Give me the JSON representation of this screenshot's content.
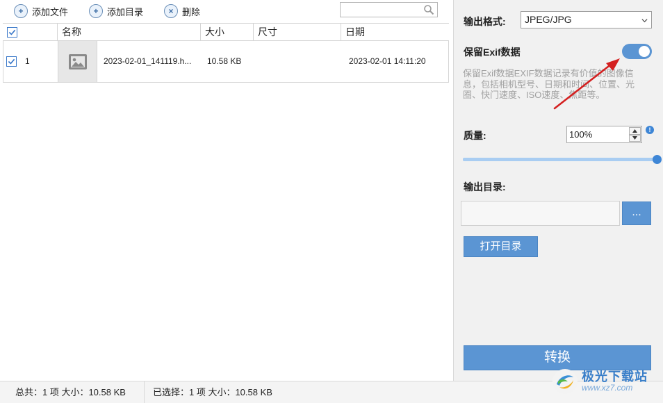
{
  "toolbar": {
    "add_file": "添加文件",
    "add_dir": "添加目录",
    "delete": "删除",
    "search_value": ""
  },
  "table": {
    "columns": [
      "名称",
      "大小",
      "尺寸",
      "日期"
    ],
    "rows": [
      {
        "index": "1",
        "checked": true,
        "name": "2023-02-01_141119.h...",
        "size": "10.58 KB",
        "dimensions": "",
        "date": "2023-02-01 14:11:20"
      }
    ]
  },
  "status": {
    "total": "总共：1 项 大小：10.58 KB",
    "selected": "已选择：1 项 大小：10.58 KB"
  },
  "panel": {
    "output_format_label": "输出格式:",
    "output_format_value": "JPEG/JPG",
    "keep_exif_label": "保留Exif数据",
    "keep_exif_on": true,
    "exif_description": "保留Exif数据EXIF数据记录有价值的图像信息，包括相机型号、日期和时间、位置、光圈、快门速度、ISO速度、焦距等。",
    "quality_label": "质量:",
    "quality_value": "100%",
    "quality_level": 100,
    "info_badge": "!",
    "output_dir_label": "输出目录:",
    "output_dir_value": "",
    "browse_label": "...",
    "open_dir_label": "打开目录",
    "convert_label": "转换"
  },
  "watermark": {
    "title": "极光下载站",
    "url": "www.xz7.com"
  },
  "colors": {
    "accent": "#5b95d3",
    "annotation_arrow": "#d42020"
  }
}
